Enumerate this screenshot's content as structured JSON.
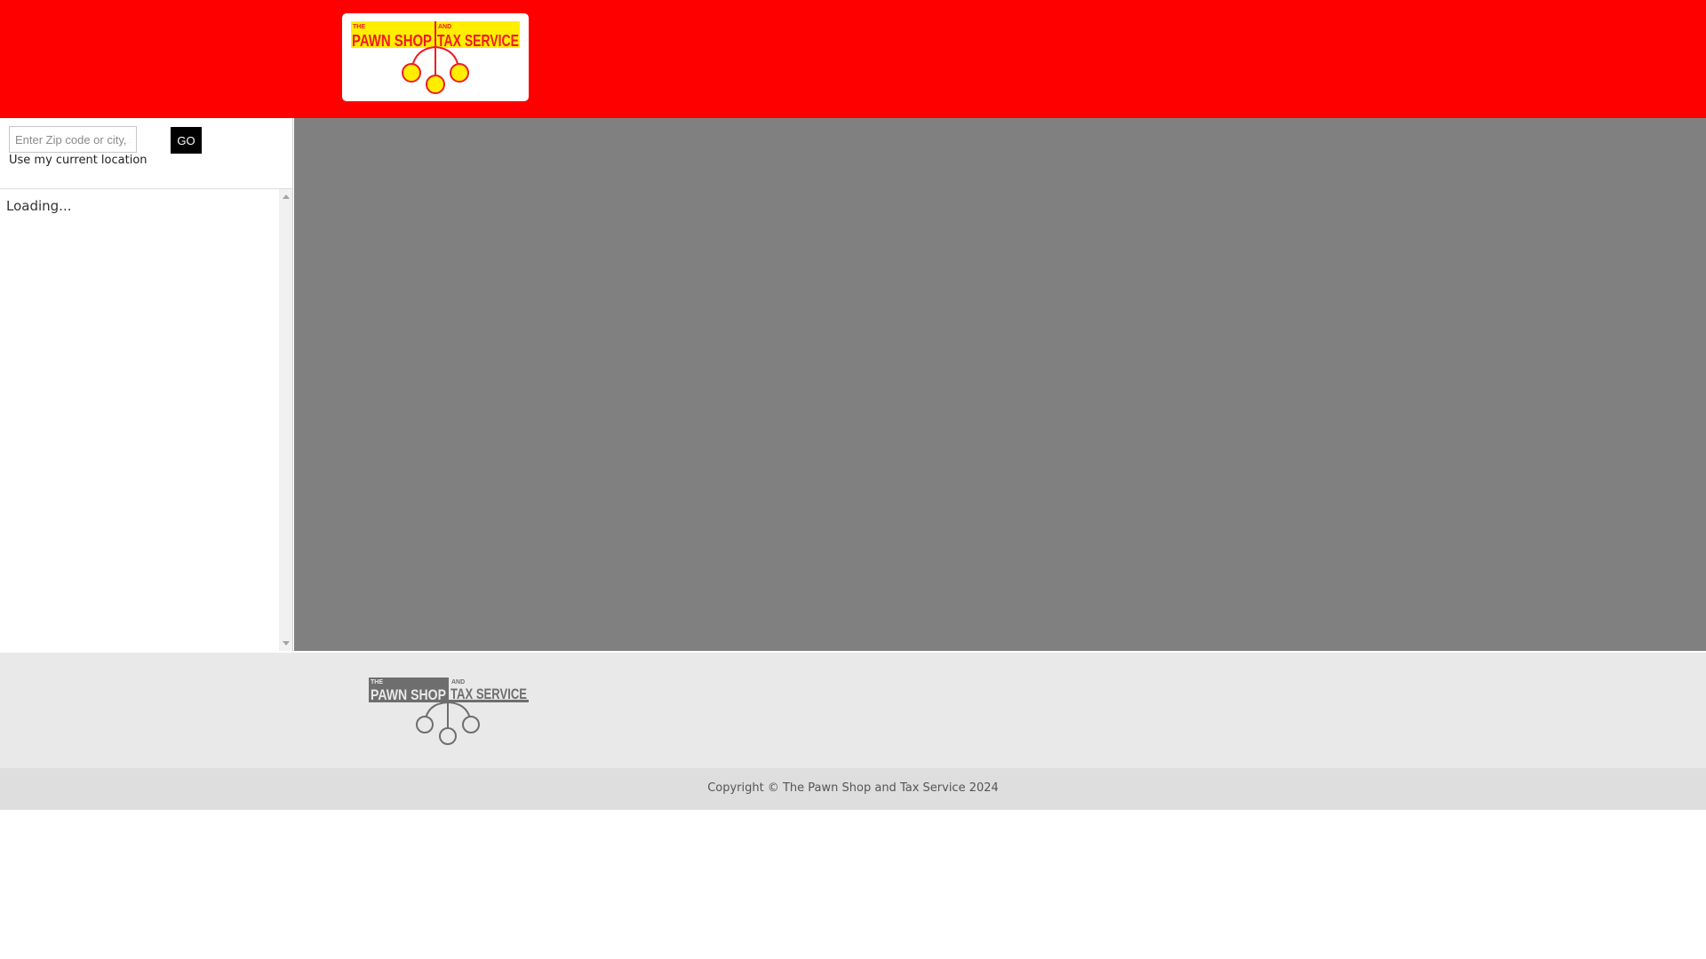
{
  "header": {
    "background_color": "#ff0000",
    "logo": {
      "line1": "THE",
      "line2": "PAWN SHOP",
      "line3": "AND",
      "line4": "TAX SERVICE",
      "yellow": "#ffee00",
      "red": "#ee1c24"
    }
  },
  "sidebar": {
    "search": {
      "placeholder": "Enter Zip code or city, state",
      "value": ""
    },
    "go_label": "GO",
    "use_location_label": "Use my current location",
    "loading_text": "Loading..."
  },
  "map": {
    "background_color": "#808080"
  },
  "footer": {
    "logo": {
      "line1": "THE",
      "line2": "PAWN SHOP",
      "line3": "AND",
      "line4": "TAX SERVICE",
      "color": "#6e6e6e"
    },
    "copyright": "Copyright © The Pawn Shop and Tax Service 2024"
  }
}
